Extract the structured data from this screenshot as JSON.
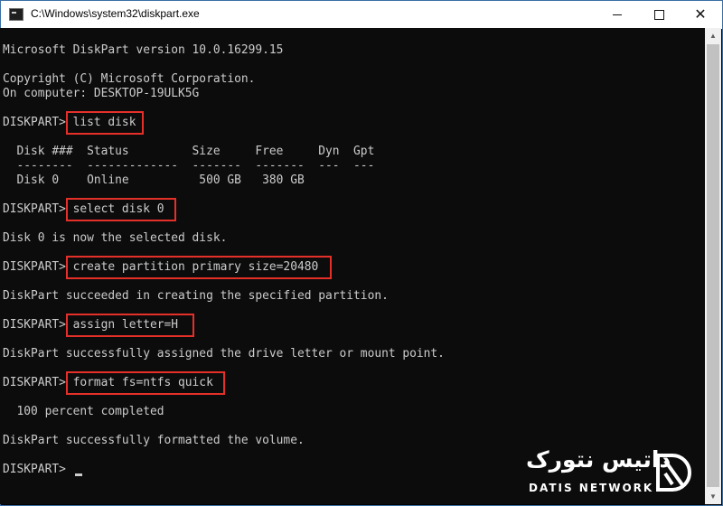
{
  "window": {
    "title": "C:\\Windows\\system32\\diskpart.exe",
    "minimize_icon": "minimize-icon",
    "maximize_icon": "maximize-icon",
    "close_icon": "close-icon"
  },
  "console": {
    "version_line": "Microsoft DiskPart version 10.0.16299.15",
    "copyright_line": "Copyright (C) Microsoft Corporation.",
    "computer_line": "On computer: DESKTOP-19ULK5G",
    "prompt": "DISKPART> ",
    "commands": [
      "list disk",
      "select disk 0",
      "create partition primary size=20480",
      "assign letter=H",
      "format fs=ntfs quick"
    ],
    "disk_table": {
      "header": "  Disk ###  Status         Size     Free     Dyn  Gpt",
      "separator": "  --------  -------------  -------  -------  ---  ---",
      "rows": [
        "  Disk 0    Online          500 GB   380 GB"
      ]
    },
    "outputs": {
      "select": "Disk 0 is now the selected disk.",
      "create": "DiskPart succeeded in creating the specified partition.",
      "assign": "DiskPart successfully assigned the drive letter or mount point.",
      "format_progress": "  100 percent completed",
      "format_done": "DiskPart successfully formatted the volume."
    },
    "final_prompt": "DISKPART> "
  },
  "watermark": {
    "persian_text": "داتیس نتورک",
    "english_text": "DATIS NETWORK"
  },
  "colors": {
    "console_bg": "#0c0c0c",
    "console_text": "#cccccc",
    "highlight_box": "#e5302a"
  }
}
